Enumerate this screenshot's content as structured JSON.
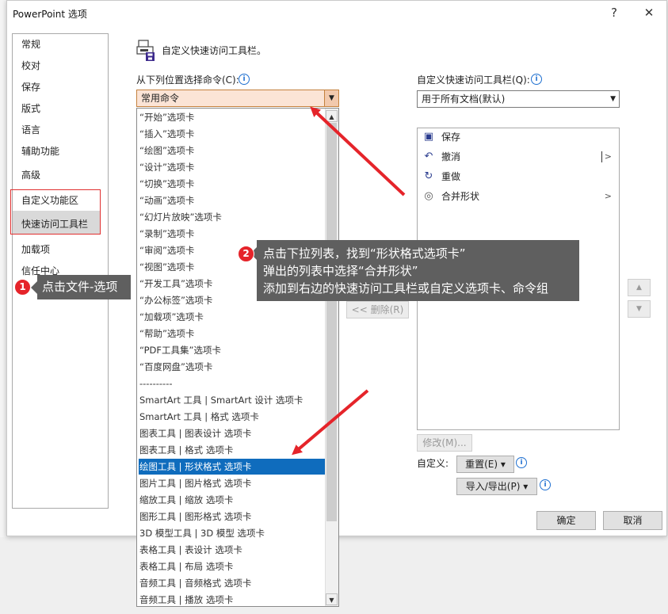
{
  "window": {
    "title": "PowerPoint 选项",
    "help_glyph": "?",
    "close_glyph": "✕"
  },
  "categories": [
    {
      "label": "常规"
    },
    {
      "label": "校对"
    },
    {
      "label": "保存"
    },
    {
      "label": "版式"
    },
    {
      "label": "语言"
    },
    {
      "label": "辅助功能"
    },
    {
      "label": "高级"
    },
    {
      "label": "自定义功能区"
    },
    {
      "label": "快速访问工具栏"
    },
    {
      "label": "加载项"
    },
    {
      "label": "信任中心"
    }
  ],
  "header": {
    "title": "自定义快速访问工具栏。"
  },
  "left_panel": {
    "label": "从下列位置选择命令(C):",
    "selected": "常用命令",
    "options": [
      "“开始”选项卡",
      "“插入”选项卡",
      "“绘图”选项卡",
      "“设计”选项卡",
      "“切换”选项卡",
      "“动画”选项卡",
      "“幻灯片放映”选项卡",
      "“录制”选项卡",
      "“审阅”选项卡",
      "“视图”选项卡",
      "“开发工具”选项卡",
      "“办公标签”选项卡",
      "“加载项”选项卡",
      "“帮助”选项卡",
      "“PDF工具集”选项卡",
      "“百度网盘”选项卡",
      "----------",
      "SmartArt 工具 | SmartArt 设计 选项卡",
      "SmartArt 工具 | 格式 选项卡",
      "图表工具 | 图表设计 选项卡",
      "图表工具 | 格式 选项卡",
      "绘图工具 | 形状格式 选项卡",
      "图片工具 | 图片格式 选项卡",
      "缩放工具 | 缩放 选项卡",
      "图形工具 | 图形格式 选项卡",
      "3D 模型工具 | 3D 模型 选项卡",
      "表格工具 | 表设计 选项卡",
      "表格工具 | 布局 选项卡",
      "音频工具 | 音频格式 选项卡",
      "音频工具 | 播放 选项卡"
    ],
    "selected_option_index": 21
  },
  "right_panel": {
    "label": "自定义快速访问工具栏(Q):",
    "selected": "用于所有文档(默认)",
    "items": [
      {
        "label": "保存",
        "icon": "save-icon",
        "glyph": "▣",
        "color": "#2b3d8f"
      },
      {
        "label": "撤消",
        "icon": "undo-icon",
        "glyph": "↶",
        "color": "#2b3d8f",
        "has_split": true
      },
      {
        "label": "重做",
        "icon": "redo-icon",
        "glyph": "↻",
        "color": "#2b3d8f"
      },
      {
        "label": "合并形状",
        "icon": "merge-shapes-icon",
        "glyph": "◎",
        "color": "#555555",
        "has_submenu": true
      }
    ]
  },
  "buttons": {
    "remove": "<< 删除(R)",
    "modify": "修改(M)...",
    "customize_label": "自定义:",
    "reset": "重置(E) ▾",
    "import_export": "导入/导出(P) ▾",
    "ok": "确定",
    "cancel": "取消",
    "move_up": "▲",
    "move_down": "▼"
  },
  "annotations": {
    "callout1": {
      "badge": "1",
      "text": "点击文件-选项"
    },
    "callout2": {
      "badge": "2",
      "lines": [
        "点击下拉列表，找到“形状格式选项卡”",
        "弹出的列表中选择“合并形状”",
        "添加到右边的快速访问工具栏或自定义选项卡、命令组"
      ]
    }
  },
  "colors": {
    "accent_selection": "#0f6cbd",
    "annotation_red": "#e5242a",
    "callout_bg": "#5f5f5f",
    "dropdown_highlight": "#fbe4d6"
  }
}
